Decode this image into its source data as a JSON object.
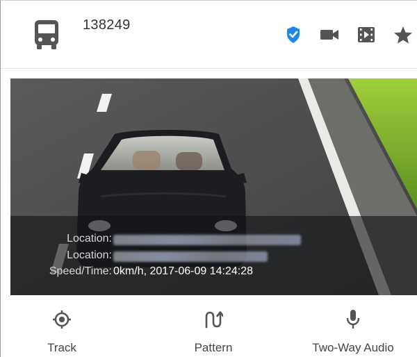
{
  "header": {
    "vehicle_id": "138249",
    "icons": [
      "bus-icon",
      "verified-shield-icon",
      "video-camera-icon",
      "playback-film-icon",
      "favorite-star-icon"
    ]
  },
  "colors": {
    "accent": "#1e88e5",
    "icon_gray": "#555555",
    "text": "#333333"
  },
  "snapshot": {
    "rows": [
      {
        "label": "Location:",
        "value": ""
      },
      {
        "label": "Location:",
        "value": ""
      },
      {
        "label": "Speed/Time:",
        "value": "0km/h, 2017-06-09 14:24:28"
      }
    ]
  },
  "actions": [
    {
      "label": "Track",
      "icon": "crosshair-icon"
    },
    {
      "label": "Pattern",
      "icon": "pattern-arrows-icon"
    },
    {
      "label": "Two-Way Audio",
      "icon": "microphone-icon"
    }
  ]
}
